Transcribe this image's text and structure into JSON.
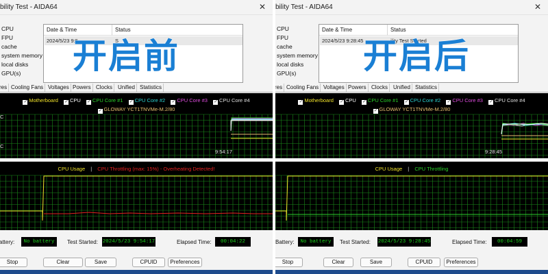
{
  "before": {
    "window_title": "bility Test - AIDA64",
    "overlay_label": "开启前",
    "sensors": [
      "CPU",
      "FPU",
      "cache",
      "system memory",
      "local disks",
      "GPU(s)"
    ],
    "status": {
      "col_datetime": "Date & Time",
      "col_status": "Status",
      "row_datetime": "2024/5/23 9:5",
      "row_status": "S"
    },
    "tabs": [
      "res",
      "Cooling Fans",
      "Voltages",
      "Powers",
      "Clocks",
      "Unified",
      "Statistics"
    ],
    "graph1": {
      "legend": [
        "Motherboard",
        "CPU",
        "CPU Core #1",
        "CPU Core #2",
        "CPU Core #3",
        "CPU Core #4"
      ],
      "legend2": "GLOWAY YCT1TNVMe-M.2/80",
      "axis_top": "C",
      "axis_bottom": "C",
      "time": "9:54:17"
    },
    "graph2": {
      "legend_a": "CPU Usage",
      "legend_b": "CPU Throttling (max: 15%) - Overheating Detected!",
      "throttle_color": "#e52020"
    },
    "info": {
      "battery_label": "attery:",
      "battery_value": "No battery",
      "started_label": "Test Started:",
      "started_value": "2024/5/23 9:54:17",
      "elapsed_label": "Elapsed Time:",
      "elapsed_value": "00:04:22"
    },
    "buttons": [
      "Stop",
      "Clear",
      "Save",
      "CPUID",
      "Preferences"
    ]
  },
  "after": {
    "window_title": "bility Test - AIDA64",
    "overlay_label": "开启后",
    "sensors": [
      "CPU",
      "FPU",
      "cache",
      "system memory",
      "local disks",
      "GPU(s)"
    ],
    "status": {
      "col_datetime": "Date & Time",
      "col_status": "Status",
      "row_datetime": "2024/5/23 9:28:45",
      "row_status": "ility Test Started"
    },
    "tabs": [
      "res",
      "Cooling Fans",
      "Voltages",
      "Powers",
      "Clocks",
      "Unified",
      "Statistics"
    ],
    "graph1": {
      "legend": [
        "Motherboard",
        "CPU",
        "CPU Core #1",
        "CPU Core #2",
        "CPU Core #3",
        "CPU Core #4"
      ],
      "legend2": "GLOWAY YCT1TNVMe-M.2/80",
      "axis_top": "",
      "axis_bottom": "",
      "time": "9:28:45"
    },
    "graph2": {
      "legend_a": "CPU Usage",
      "legend_b": "CPU Throttling",
      "throttle_color": "#2ad12a"
    },
    "info": {
      "battery_label": "Battery:",
      "battery_value": "No battery",
      "started_label": "Test Started:",
      "started_value": "2024/5/23 9:28:45",
      "elapsed_label": "Elapsed Time:",
      "elapsed_value": "00:04:59"
    },
    "buttons": [
      "Stop",
      "Clear",
      "Save",
      "CPUID",
      "Preferences"
    ]
  },
  "colors": {
    "motherboard": "#f2e32a",
    "cpu": "#ffffff",
    "core1": "#2ad12a",
    "core2": "#2ad1d1",
    "core3": "#e14de1",
    "core4": "#e0e0e0",
    "ssd": "#e8c070",
    "cpu_usage": "#f2e32a",
    "grid": "#1a8a1a"
  }
}
